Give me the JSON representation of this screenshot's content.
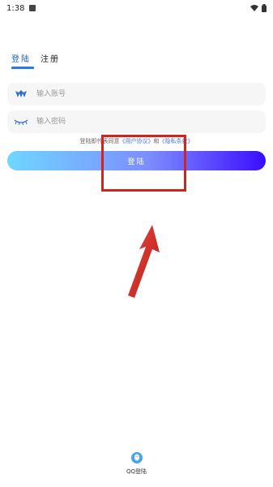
{
  "status_bar": {
    "time": "1:38",
    "icons": [
      "notification-icon",
      "wifi-icon",
      "battery-icon"
    ]
  },
  "tabs": [
    {
      "label": "登陆",
      "active": true
    },
    {
      "label": "注册",
      "active": false
    }
  ],
  "fields": {
    "account": {
      "placeholder": "输入账号",
      "icon": "logo-icon"
    },
    "password": {
      "placeholder": "输入密码",
      "icon": "eye-closed-icon"
    }
  },
  "agreement": {
    "prefix": "登陆即代表同意",
    "user_agreement": "《用户协议》",
    "and": "和",
    "privacy_policy": "《隐私条款》"
  },
  "login_button": {
    "label": "登陆"
  },
  "qq_login": {
    "label": "QQ登陆",
    "icon": "qq-icon"
  },
  "colors": {
    "tab_active": "#2c7be5",
    "button_gradient_start": "#6fd6ff",
    "button_gradient_end": "#3b0dff",
    "annotation": "#d0241d"
  }
}
